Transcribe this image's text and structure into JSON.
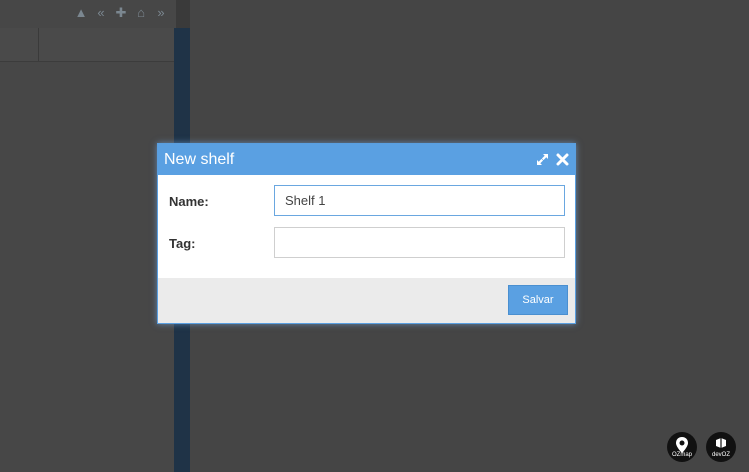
{
  "dialog": {
    "title": "New shelf",
    "fields": {
      "name_label": "Name:",
      "name_value": "Shelf 1",
      "tag_label": "Tag:",
      "tag_value": ""
    },
    "save_label": "Salvar"
  },
  "background": {
    "nav_icons": [
      "up-icon",
      "prev-icon",
      "share-icon",
      "home-icon",
      "next-icon"
    ]
  },
  "logos": {
    "ozmap": "OZmap",
    "devoz": "devOZ"
  },
  "colors": {
    "accent": "#5aa0e2",
    "overlay": "#454545",
    "footer": "#ebebeb"
  }
}
